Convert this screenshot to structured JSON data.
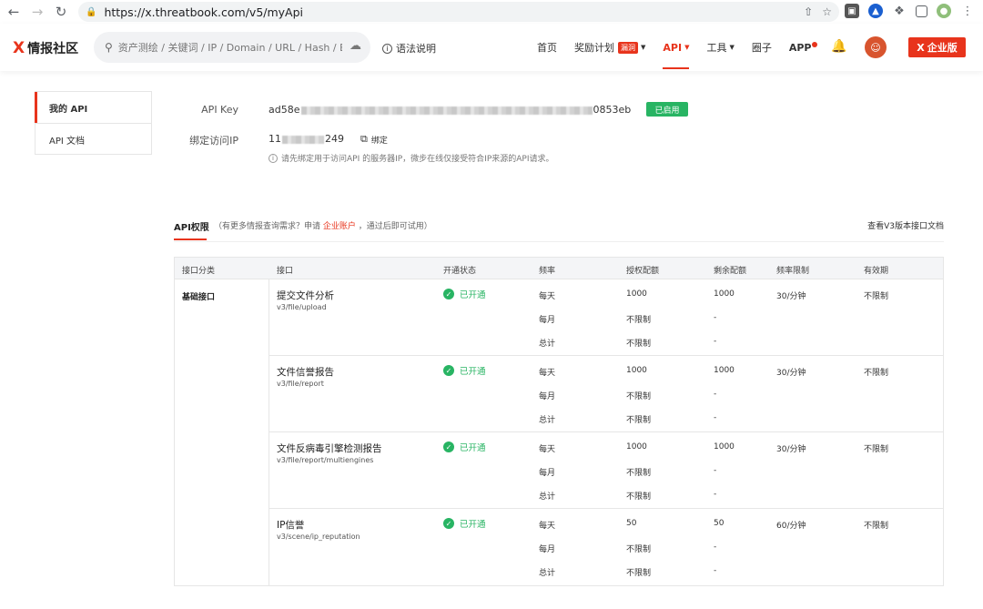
{
  "browser": {
    "url": "https://x.threatbook.com/v5/myApi"
  },
  "header": {
    "logo_text": "情报社区",
    "search_placeholder": "资产测绘 / 关键词 / IP / Domain / URL / Hash / Em...",
    "syntax_label": "语法说明",
    "nav": [
      {
        "label": "首页"
      },
      {
        "label": "奖励计划",
        "badge": "漏洞"
      },
      {
        "label": "API"
      },
      {
        "label": "工具"
      },
      {
        "label": "圈子"
      },
      {
        "label": "APP"
      }
    ],
    "enterprise_label": "企业版",
    "accent_color": "#e8341c"
  },
  "sidebar": {
    "items": [
      {
        "label": "我的 API"
      },
      {
        "label": "API 文档"
      }
    ]
  },
  "key_info": {
    "api_key_label": "API Key",
    "api_key_prefix": "ad58e",
    "api_key_suffix": "0853eb",
    "status_badge": "已启用",
    "ip_label": "绑定访问IP",
    "ip_prefix": "11",
    "ip_suffix": "249",
    "bind_label": "绑定",
    "hint": "请先绑定用于访问API 的服务器IP，微步在线仅接受符合IP来源的API请求。"
  },
  "permissions": {
    "title": "API权限",
    "note_prefix": "（有更多情报查询需求？申请",
    "note_link": "企业账户",
    "note_suffix": "，通过后即可试用）",
    "doc_link": "查看V3版本接口文档",
    "columns": [
      "接口分类",
      "接口",
      "开通状态",
      "频率",
      "授权配额",
      "剩余配额",
      "频率限制",
      "有效期"
    ],
    "category": "基础接口",
    "apis": [
      {
        "name": "提交文件分析",
        "path": "v3/file/upload",
        "status": "已开通",
        "rows": [
          {
            "period": "每天",
            "quota": "1000",
            "remaining": "1000"
          },
          {
            "period": "每月",
            "quota": "不限制",
            "remaining": "-"
          },
          {
            "period": "总计",
            "quota": "不限制",
            "remaining": "-"
          }
        ],
        "rate_limit": "30/分钟",
        "validity": "不限制"
      },
      {
        "name": "文件信誉报告",
        "path": "v3/file/report",
        "status": "已开通",
        "rows": [
          {
            "period": "每天",
            "quota": "1000",
            "remaining": "1000"
          },
          {
            "period": "每月",
            "quota": "不限制",
            "remaining": "-"
          },
          {
            "period": "总计",
            "quota": "不限制",
            "remaining": "-"
          }
        ],
        "rate_limit": "30/分钟",
        "validity": "不限制"
      },
      {
        "name": "文件反病毒引擎检测报告",
        "path": "v3/file/report/multiengines",
        "status": "已开通",
        "rows": [
          {
            "period": "每天",
            "quota": "1000",
            "remaining": "1000"
          },
          {
            "period": "每月",
            "quota": "不限制",
            "remaining": "-"
          },
          {
            "period": "总计",
            "quota": "不限制",
            "remaining": "-"
          }
        ],
        "rate_limit": "30/分钟",
        "validity": "不限制"
      },
      {
        "name": "IP信誉",
        "path": "v3/scene/ip_reputation",
        "status": "已开通",
        "rows": [
          {
            "period": "每天",
            "quota": "50",
            "remaining": "50"
          },
          {
            "period": "每月",
            "quota": "不限制",
            "remaining": "-"
          },
          {
            "period": "总计",
            "quota": "不限制",
            "remaining": "-"
          }
        ],
        "rate_limit": "60/分钟",
        "validity": "不限制"
      }
    ]
  }
}
